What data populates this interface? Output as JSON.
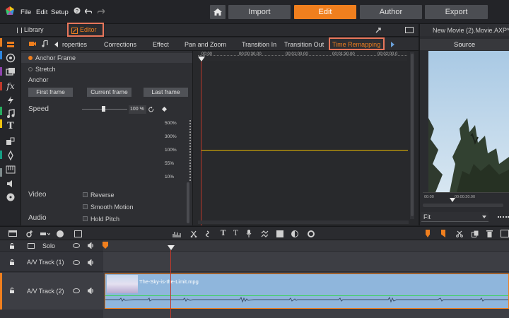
{
  "menu": {
    "file": "File",
    "edit": "Edit",
    "setup": "Setup"
  },
  "modes": {
    "import": "Import",
    "edit": "Edit",
    "author": "Author",
    "export": "Export",
    "active": "edit"
  },
  "subtabs": {
    "library": "Library",
    "editor": "Editor"
  },
  "project_title": "New Movie (2).Movie.AXP*",
  "source_label": "Source",
  "editor_tabs": [
    "roperties",
    "Corrections",
    "Effect",
    "Pan and Zoom",
    "Transition In",
    "Transition Out",
    "Time Remapping"
  ],
  "left_panel": {
    "anchor_frame": "Anchor Frame",
    "stretch": "Stretch",
    "anchor": "Anchor",
    "first_frame": "First frame",
    "current_frame": "Current frame",
    "last_frame": "Last frame",
    "speed": "Speed",
    "speed_value": "100 %",
    "speed_fraction": 0.5,
    "video": "Video",
    "reverse": "Reverse",
    "smooth_motion": "Smooth Motion",
    "audio": "Audio",
    "hold_pitch": "Hold Pitch",
    "pct_labels": [
      "500%",
      "300%",
      "100%",
      "55%",
      "10%"
    ]
  },
  "remap_ruler": [
    "00:00",
    "00:00:30.00",
    "00:01:00.00",
    "00:01:30.00",
    "00:02:00.0"
  ],
  "source_ruler": [
    "00:00",
    "00:00:20.00"
  ],
  "source_fit": "Fit",
  "tracks": [
    {
      "name": "Solo"
    },
    {
      "name": "A/V Track (1)"
    },
    {
      "name": "A/V Track (2)"
    }
  ],
  "clip": {
    "name": "The-Sky-is-the-Limit.mpg"
  },
  "colors": {
    "accent": "#f07f1e",
    "highlight_box": "#e8765b",
    "speed_line": "#e8b800",
    "playhead": "#c0392b",
    "clip_fill": "#8fb6dc"
  }
}
